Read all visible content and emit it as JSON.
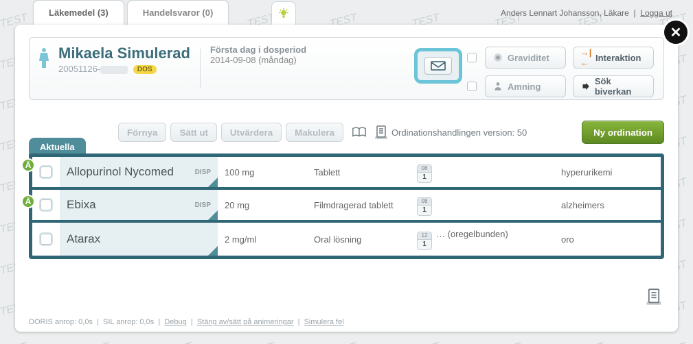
{
  "tabs": {
    "medicines": "Läkemedel (3)",
    "goods": "Handelsvaror (0)"
  },
  "user": {
    "name": "Anders Lennart Johansson, Läkare",
    "logout": "Logga ut"
  },
  "patient": {
    "name": "Mikaela Simulerad",
    "pnr": "20051126-",
    "dos": "DOS",
    "dose_label": "Första dag i dosperiod",
    "dose_date": "2014-09-08 (måndag)"
  },
  "flags": {
    "pregnancy": "Graviditet",
    "nursing": "Amning",
    "interaction": "Interaktion",
    "sideeffect": "Sök biverkan"
  },
  "toolbar": {
    "fornya": "Förnya",
    "sattut": "Sätt ut",
    "utvardera": "Utvärdera",
    "makulera": "Makulera",
    "version": "Ordinationshandlingen version: 50",
    "nyord": "Ny ordination",
    "currentTab": "Aktuella"
  },
  "rows": [
    {
      "name": "Allopurinol Nycomed",
      "disp": "DISP",
      "dose": "100 mg",
      "form": "Tablett",
      "schedTop": "08",
      "schedNum": "1",
      "extra": "",
      "reason": "hyperurikemi"
    },
    {
      "name": "Ebixa",
      "disp": "DISP",
      "dose": "20 mg",
      "form": "Filmdragerad tablett",
      "schedTop": "08",
      "schedNum": "1",
      "extra": "",
      "reason": "alzheimers"
    },
    {
      "name": "Atarax",
      "disp": "",
      "dose": "2 mg/ml",
      "form": "Oral lösning",
      "schedTop": "12",
      "schedNum": "1",
      "extra": "… (oregelbunden)",
      "reason": "oro"
    }
  ],
  "footer": {
    "doris": "DORIS anrop: 0,0s",
    "sil": "SIL anrop: 0,0s",
    "debug": "Debug",
    "anim": "Stäng av/sätt på animeringar",
    "sim": "Simulera fel"
  }
}
